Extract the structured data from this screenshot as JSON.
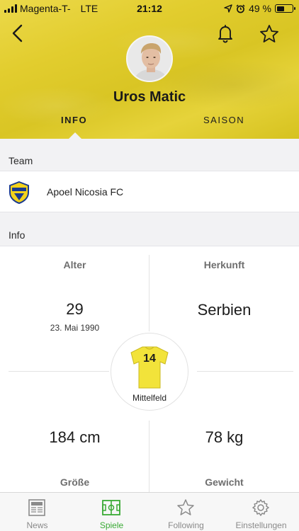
{
  "status_bar": {
    "carrier": "Magenta-T-",
    "network": "LTE",
    "time": "21:12",
    "battery": "49 %",
    "battery_level": 0.49
  },
  "player": {
    "name": "Uros Matic",
    "avatar_icon": "player-portrait"
  },
  "tabs": [
    {
      "label": "INFO",
      "active": true
    },
    {
      "label": "SAISON",
      "active": false
    }
  ],
  "team_section": {
    "heading": "Team",
    "team_name": "Apoel Nicosia FC",
    "crest_icon": "apoel-crest-icon"
  },
  "info_section": {
    "heading": "Info",
    "age_label": "Alter",
    "age_value": "29",
    "birth_date": "23. Mai 1990",
    "origin_label": "Herkunft",
    "origin_value": "Serbien",
    "jersey_number": "14",
    "position": "Mittelfeld",
    "height_value": "184 cm",
    "height_label": "Größe",
    "weight_value": "78 kg",
    "weight_label": "Gewicht"
  },
  "tab_bar": [
    {
      "label": "News",
      "icon": "newspaper-icon",
      "active": false
    },
    {
      "label": "Spiele",
      "icon": "pitch-icon",
      "active": true
    },
    {
      "label": "Following",
      "icon": "star-icon",
      "active": false
    },
    {
      "label": "Einstellungen",
      "icon": "gear-icon",
      "active": false
    }
  ],
  "colors": {
    "header_yellow": "#e2cd2e",
    "active_green": "#3aaa35",
    "jersey_yellow": "#f2e33a"
  }
}
